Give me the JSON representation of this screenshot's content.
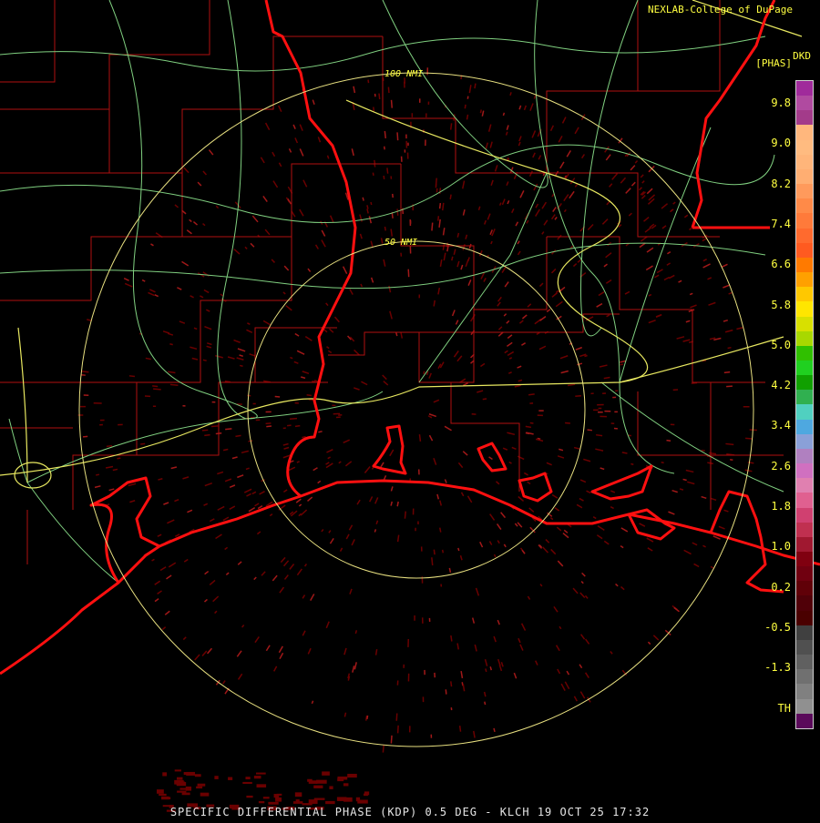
{
  "header": {
    "credit": "NEXLAB-College of DuPage",
    "product_code": "DKD",
    "unit": "[PHAS]"
  },
  "rings": [
    {
      "label": "100 NMI"
    },
    {
      "label": "50 NMI"
    }
  ],
  "footer": {
    "caption": "SPECIFIC DIFFERENTIAL PHASE (KDP) 0.5 DEG - KLCH 19 OCT 25 17:32"
  },
  "color_scale": {
    "tick_labels": [
      "9.8",
      "9.0",
      "8.2",
      "7.4",
      "6.6",
      "5.8",
      "5.0",
      "4.2",
      "3.4",
      "2.6",
      "1.8",
      "1.0",
      "0.2",
      "-0.5",
      "-1.3",
      "TH"
    ],
    "colors": [
      "#a02a9b",
      "#b04aa0",
      "#a33b8a",
      "#ffb77d",
      "#ffbb80",
      "#ffb57a",
      "#ffae72",
      "#ff9a5c",
      "#ff8a48",
      "#ff7a3a",
      "#ff6a2e",
      "#ff5a20",
      "#ff7a00",
      "#ffa000",
      "#ffc800",
      "#ffe600",
      "#d8e000",
      "#a8d800",
      "#30c000",
      "#20d020",
      "#10a000",
      "#30b050",
      "#50d0c0",
      "#4ea8e0",
      "#8aa0d8",
      "#b080c0",
      "#d070c0",
      "#e080b0",
      "#e06090",
      "#d04070",
      "#c03050",
      "#a01830",
      "#800010",
      "#700010",
      "#600008",
      "#500008",
      "#4a0000",
      "#404040",
      "#505050",
      "#606060",
      "#707070",
      "#808080",
      "#909090",
      "#5a0a5a"
    ],
    "colors_note": "top to bottom"
  },
  "colors": {
    "coastline": "#ff1010",
    "county_lines": "#b01010",
    "highways": "#80d080",
    "interstates": "#e8e860",
    "range_rings": "#e8e080",
    "echo": "#7a0000"
  }
}
